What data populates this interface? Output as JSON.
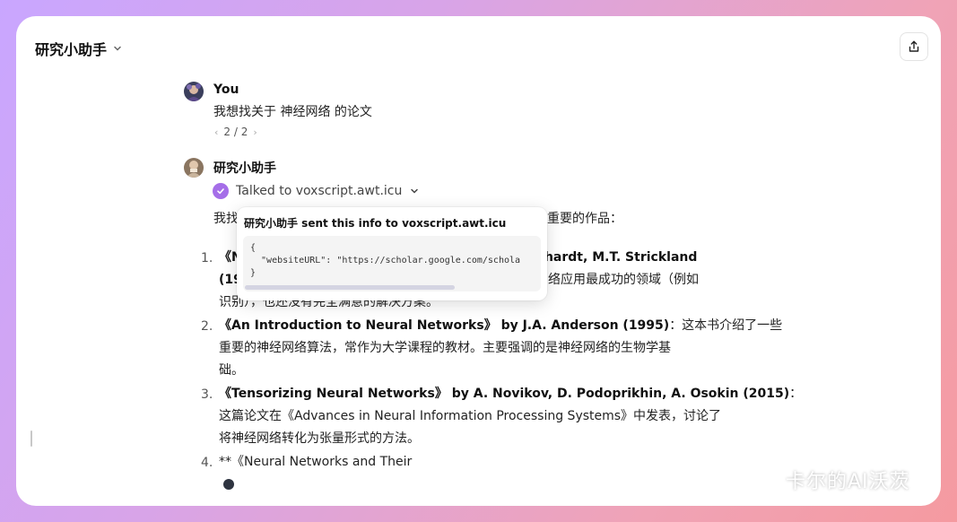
{
  "app": {
    "title": "研究小助手"
  },
  "user_message": {
    "name": "You",
    "text": "我想找关于 神经网络 的论文",
    "pager": "2 / 2"
  },
  "assistant": {
    "name": "研究小助手",
    "tool_status": "Talked to voxscript.awt.icu",
    "intro_visible": "我找",
    "intro_tail": "些重要的作品："
  },
  "popup": {
    "title": "研究小助手 sent this info to voxscript.awt.icu",
    "code_lines": [
      "{",
      "  \"websiteURL\": \"https://scholar.google.com/schola",
      "}"
    ]
  },
  "list": [
    {
      "num": "1.",
      "line1_visible": "《N",
      "line1_tail": "nhardt, M.T. Strickland",
      "line2_visible": "(19",
      "line2_tail": "网络应用最成功的领域（例如",
      "line3": "识别），也还没有完全满意的解决方案。"
    },
    {
      "num": "2.",
      "title": "《An Introduction to Neural Networks》 by J.A. Anderson (1995)",
      "rest": "：这本书介绍了一些",
      "line2": "重要的神经网络算法，常作为大学课程的教材。主要强调的是神经网络的生物学基",
      "line3": "础。"
    },
    {
      "num": "3.",
      "title": "《Tensorizing Neural Networks》 by A. Novikov, D. Podoprikhin, A. Osokin (2015)",
      "rest": "：",
      "line2": "这篇论文在《Advances in Neural Information Processing Systems》中发表，讨论了",
      "line3": "将神经网络转化为张量形式的方法。"
    },
    {
      "num": "4.",
      "title": "**《Neural Networks and Their"
    }
  ],
  "watermark": {
    "text": "卡尔的AI沃茨"
  },
  "icons": {
    "share": "share-icon",
    "chevron": "chevron-down-icon",
    "check": "check-icon",
    "wechat": "wechat-icon"
  },
  "colors": {
    "accent": "#a56ee8"
  }
}
